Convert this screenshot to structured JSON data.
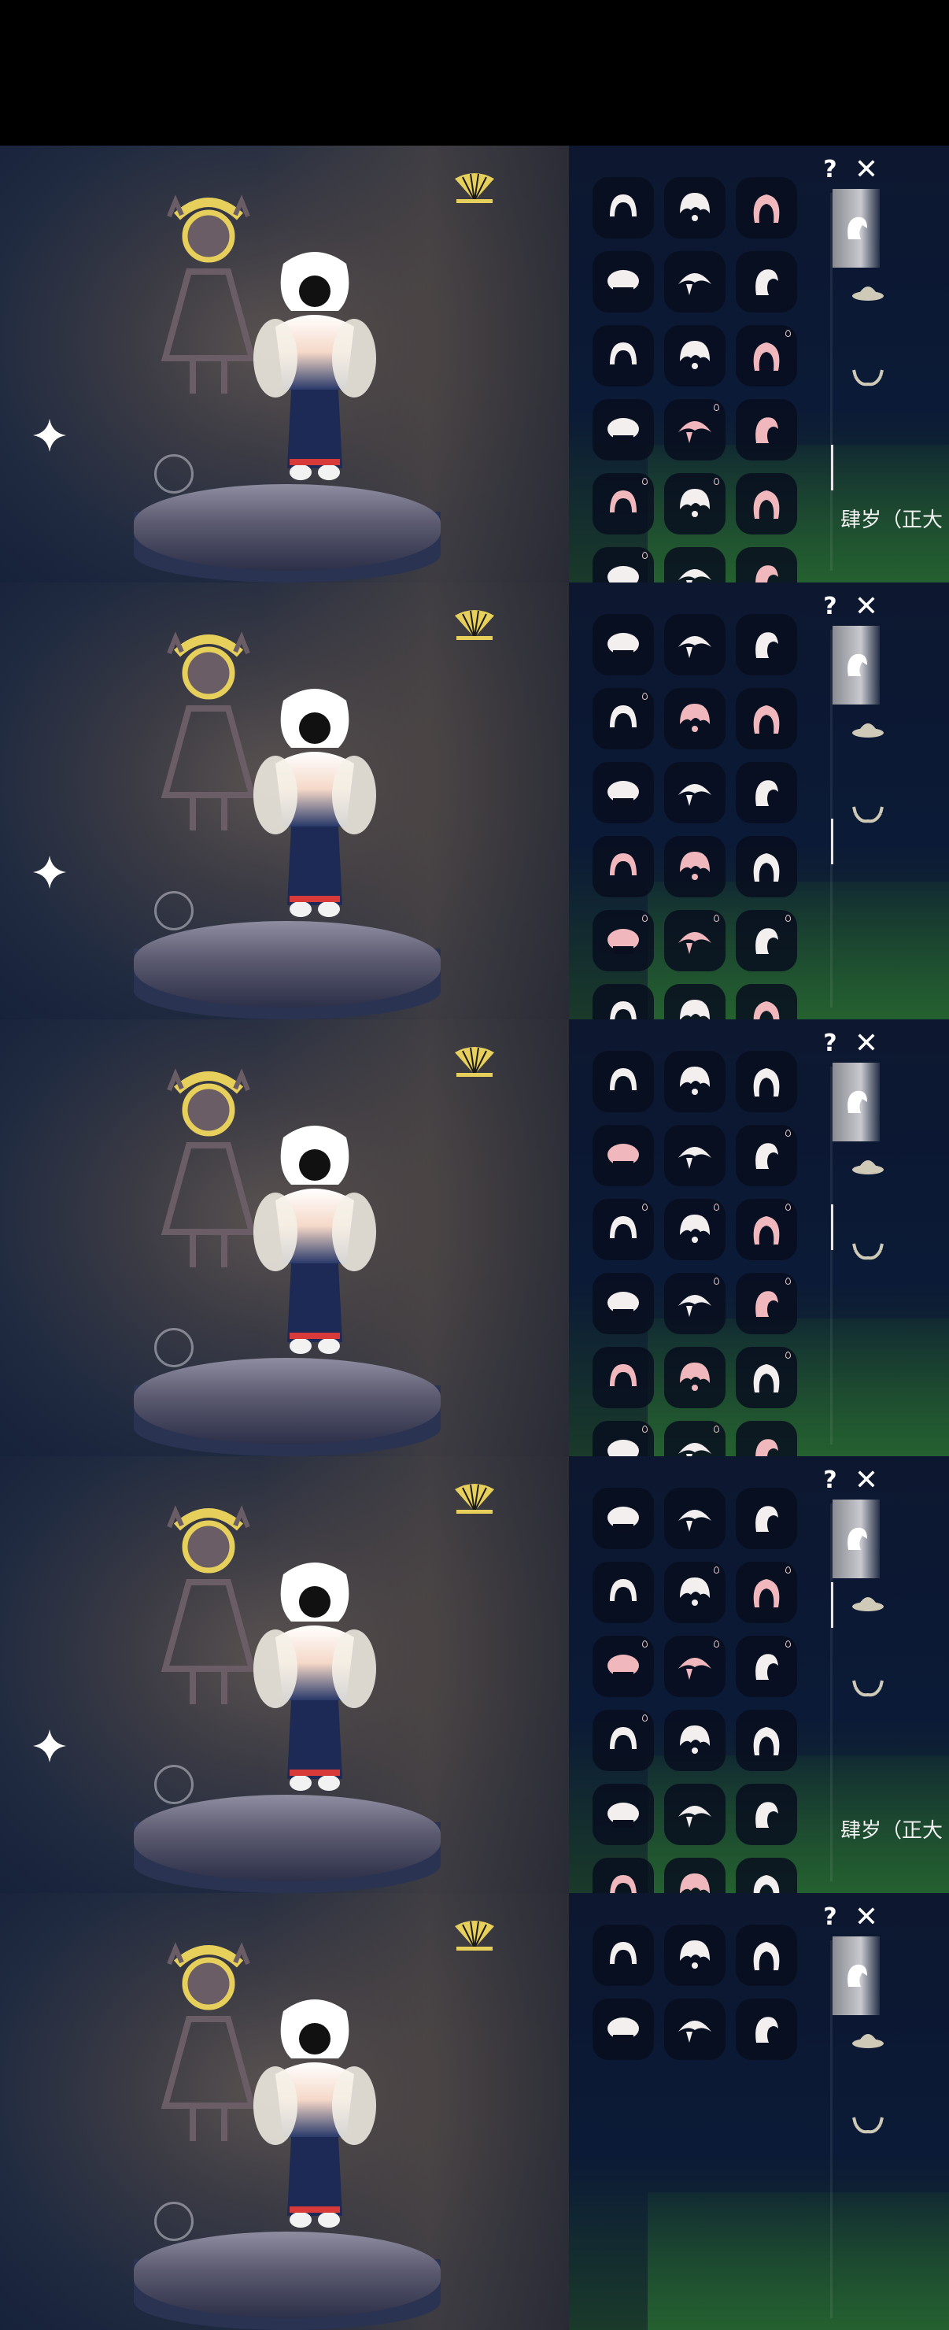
{
  "panels": [
    {
      "season_label": "肆岁（正大",
      "sparkle": true,
      "cells": [
        {
          "icon": "hair-bun-icon",
          "pink": false,
          "drop": false
        },
        {
          "icon": "hair-pigtails-icon",
          "pink": false,
          "drop": false
        },
        {
          "icon": "hair-long-pink-icon",
          "pink": true,
          "drop": false
        },
        {
          "icon": "hair-bob-icon",
          "pink": false,
          "drop": false
        },
        {
          "icon": "hair-curl-icon",
          "pink": false,
          "drop": false
        },
        {
          "icon": "hair-ponytail-icon",
          "pink": false,
          "drop": false
        },
        {
          "icon": "hair-sprout-icon",
          "pink": false,
          "drop": false
        },
        {
          "icon": "hair-messy-icon",
          "pink": false,
          "drop": false
        },
        {
          "icon": "hair-flower-icon",
          "pink": true,
          "drop": true
        },
        {
          "icon": "hair-short-icon",
          "pink": false,
          "drop": false
        },
        {
          "icon": "hair-hat-icon",
          "pink": true,
          "drop": true
        },
        {
          "icon": "hair-side-pink-icon",
          "pink": true,
          "drop": false
        },
        {
          "icon": "hair-bun-pink-icon",
          "pink": true,
          "drop": true
        },
        {
          "icon": "hair-hood-icon",
          "pink": false,
          "drop": true
        },
        {
          "icon": "hair-straight-icon",
          "pink": true,
          "drop": false
        },
        {
          "icon": "hair-braid-icon",
          "pink": false,
          "drop": true
        },
        {
          "icon": "hair-wave-icon",
          "pink": false,
          "drop": false
        },
        {
          "icon": "hair-bow-icon",
          "pink": true,
          "drop": false
        }
      ]
    },
    {
      "season_label": "",
      "sparkle": true,
      "cells": [
        {
          "icon": "hair-bob-icon",
          "pink": false,
          "drop": false
        },
        {
          "icon": "hair-hood-icon",
          "pink": false,
          "drop": false
        },
        {
          "icon": "hair-long-icon",
          "pink": false,
          "drop": false
        },
        {
          "icon": "hair-twin-buns-icon",
          "pink": false,
          "drop": true
        },
        {
          "icon": "hair-long-pink-icon",
          "pink": true,
          "drop": false
        },
        {
          "icon": "hair-side-pink-icon",
          "pink": true,
          "drop": false
        },
        {
          "icon": "hair-crown-icon",
          "pink": false,
          "drop": false
        },
        {
          "icon": "hair-braids-icon",
          "pink": false,
          "drop": false
        },
        {
          "icon": "hair-straight-icon",
          "pink": false,
          "drop": false
        },
        {
          "icon": "hair-curly-icon",
          "pink": true,
          "drop": false
        },
        {
          "icon": "hair-dreads-icon",
          "pink": true,
          "drop": false
        },
        {
          "icon": "hair-bob-icon",
          "pink": false,
          "drop": false
        },
        {
          "icon": "hair-headband-icon",
          "pink": true,
          "drop": true
        },
        {
          "icon": "hair-flower-icon",
          "pink": true,
          "drop": true
        },
        {
          "icon": "hair-spiky-icon",
          "pink": false,
          "drop": true
        },
        {
          "icon": "hair-short-icon",
          "pink": false,
          "drop": false
        },
        {
          "icon": "hair-mushroom-icon",
          "pink": false,
          "drop": false
        },
        {
          "icon": "hair-wavy-pink-icon",
          "pink": true,
          "drop": false
        }
      ]
    },
    {
      "season_label": "",
      "sparkle": false,
      "cells": [
        {
          "icon": "hair-short-icon",
          "pink": false,
          "drop": false
        },
        {
          "icon": "hair-ponytail-icon",
          "pink": false,
          "drop": false
        },
        {
          "icon": "hair-swept-icon",
          "pink": false,
          "drop": false
        },
        {
          "icon": "hair-bob-icon",
          "pink": true,
          "drop": false
        },
        {
          "icon": "hair-messy-icon",
          "pink": false,
          "drop": false
        },
        {
          "icon": "hair-wide-hat-icon",
          "pink": false,
          "drop": true
        },
        {
          "icon": "hair-curl-icon",
          "pink": false,
          "drop": true
        },
        {
          "icon": "hair-saucer-hat-icon",
          "pink": false,
          "drop": true
        },
        {
          "icon": "hair-curly-icon",
          "pink": true,
          "drop": true
        },
        {
          "icon": "hair-fluffy-icon",
          "pink": false,
          "drop": false
        },
        {
          "icon": "hair-long-icon",
          "pink": false,
          "drop": true
        },
        {
          "icon": "hair-side-pink-icon",
          "pink": true,
          "drop": true
        },
        {
          "icon": "hair-wavy-icon",
          "pink": true,
          "drop": false
        },
        {
          "icon": "hair-cap-icon",
          "pink": true,
          "drop": false
        },
        {
          "icon": "hair-spread-icon",
          "pink": false,
          "drop": true
        },
        {
          "icon": "hair-bun-icon",
          "pink": false,
          "drop": true
        },
        {
          "icon": "hair-braid-icon",
          "pink": false,
          "drop": true
        },
        {
          "icon": "hair-bow-icon",
          "pink": true,
          "drop": false
        }
      ]
    },
    {
      "season_label": "肆岁（正大",
      "sparkle": true,
      "cells": [
        {
          "icon": "hair-wing-icon",
          "pink": false,
          "drop": false
        },
        {
          "icon": "hair-peak-icon",
          "pink": false,
          "drop": false
        },
        {
          "icon": "hair-flame-icon",
          "pink": false,
          "drop": false
        },
        {
          "icon": "hood-grey-icon",
          "pink": false,
          "drop": false
        },
        {
          "icon": "hair-spiky-icon",
          "pink": false,
          "drop": true
        },
        {
          "icon": "hair-hat-bow-icon",
          "pink": true,
          "drop": true
        },
        {
          "icon": "hair-wide-hat-icon",
          "pink": true,
          "drop": true
        },
        {
          "icon": "hair-saucer-hat-icon",
          "pink": true,
          "drop": true
        },
        {
          "icon": "hair-ears-icon",
          "pink": false,
          "drop": true
        },
        {
          "icon": "hair-small-icon",
          "pink": false,
          "drop": true
        },
        {
          "icon": "hair-swirl-icon",
          "pink": false,
          "drop": false
        },
        {
          "icon": "hair-tall-icon",
          "pink": false,
          "drop": false
        },
        {
          "icon": "hair-spread-icon",
          "pink": false,
          "drop": false
        },
        {
          "icon": "hair-witch-hat-icon",
          "pink": false,
          "drop": false
        },
        {
          "icon": "hair-swept-hat-icon",
          "pink": false,
          "drop": false
        },
        {
          "icon": "hair-bun-icon",
          "pink": true,
          "drop": false
        },
        {
          "icon": "hair-twin-icon",
          "pink": true,
          "drop": false
        },
        {
          "icon": "hair-bob-icon",
          "pink": false,
          "drop": false
        }
      ]
    },
    {
      "season_label": "",
      "sparkle": false,
      "cells": [
        {
          "icon": "hair-bob-icon",
          "pink": false,
          "drop": false
        },
        {
          "icon": "hair-long-icon",
          "pink": false,
          "drop": false
        },
        {
          "icon": "hair-swept-icon",
          "pink": false,
          "drop": false
        },
        {
          "icon": "hair-round-icon",
          "pink": false,
          "drop": false
        },
        {
          "icon": "hair-flat-icon",
          "pink": false,
          "drop": false
        },
        {
          "icon": "hair-spiky-icon",
          "pink": false,
          "drop": false
        }
      ]
    }
  ],
  "ui": {
    "help_label": "?",
    "close_label": "✕"
  },
  "tabs": [
    {
      "icon": "hair-tab-icon"
    },
    {
      "icon": "hat-tab-icon"
    },
    {
      "icon": "horns-tab-icon"
    }
  ]
}
